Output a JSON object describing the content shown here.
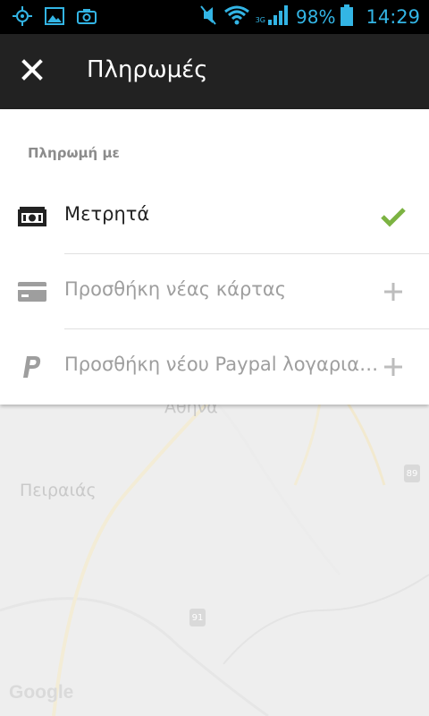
{
  "status_bar": {
    "icons_left": [
      "gps-icon",
      "image-icon",
      "camera-icon"
    ],
    "icons_right": [
      "mute-icon",
      "wifi-icon",
      "signal-icon",
      "battery-icon"
    ],
    "network_type": "3G",
    "battery": "98%",
    "time": "14:29",
    "accent_color": "#33b5e5"
  },
  "toolbar": {
    "title": "Πληρωμές",
    "close_icon": "close-icon",
    "background": "#222222"
  },
  "payments": {
    "section_header": "Πληρωμή με",
    "methods": [
      {
        "label": "Μετρητά",
        "icon": "cash-icon",
        "action": "check-icon",
        "selected": true,
        "color": "#222222"
      },
      {
        "label": "Προσθήκη νέας κάρτας",
        "icon": "credit-card-icon",
        "action": "plus-icon",
        "selected": false,
        "color": "#9e9e9e"
      },
      {
        "label": "Προσθήκη νέου Paypal λογαριασμού",
        "icon": "paypal-icon",
        "action": "plus-icon",
        "selected": false,
        "color": "#9e9e9e"
      }
    ],
    "check_color": "#7cb342"
  },
  "map": {
    "labels": [
      "Αθήνα",
      "Πειραιάς"
    ],
    "road_badges": [
      "89",
      "91"
    ],
    "attribution": "Google"
  }
}
